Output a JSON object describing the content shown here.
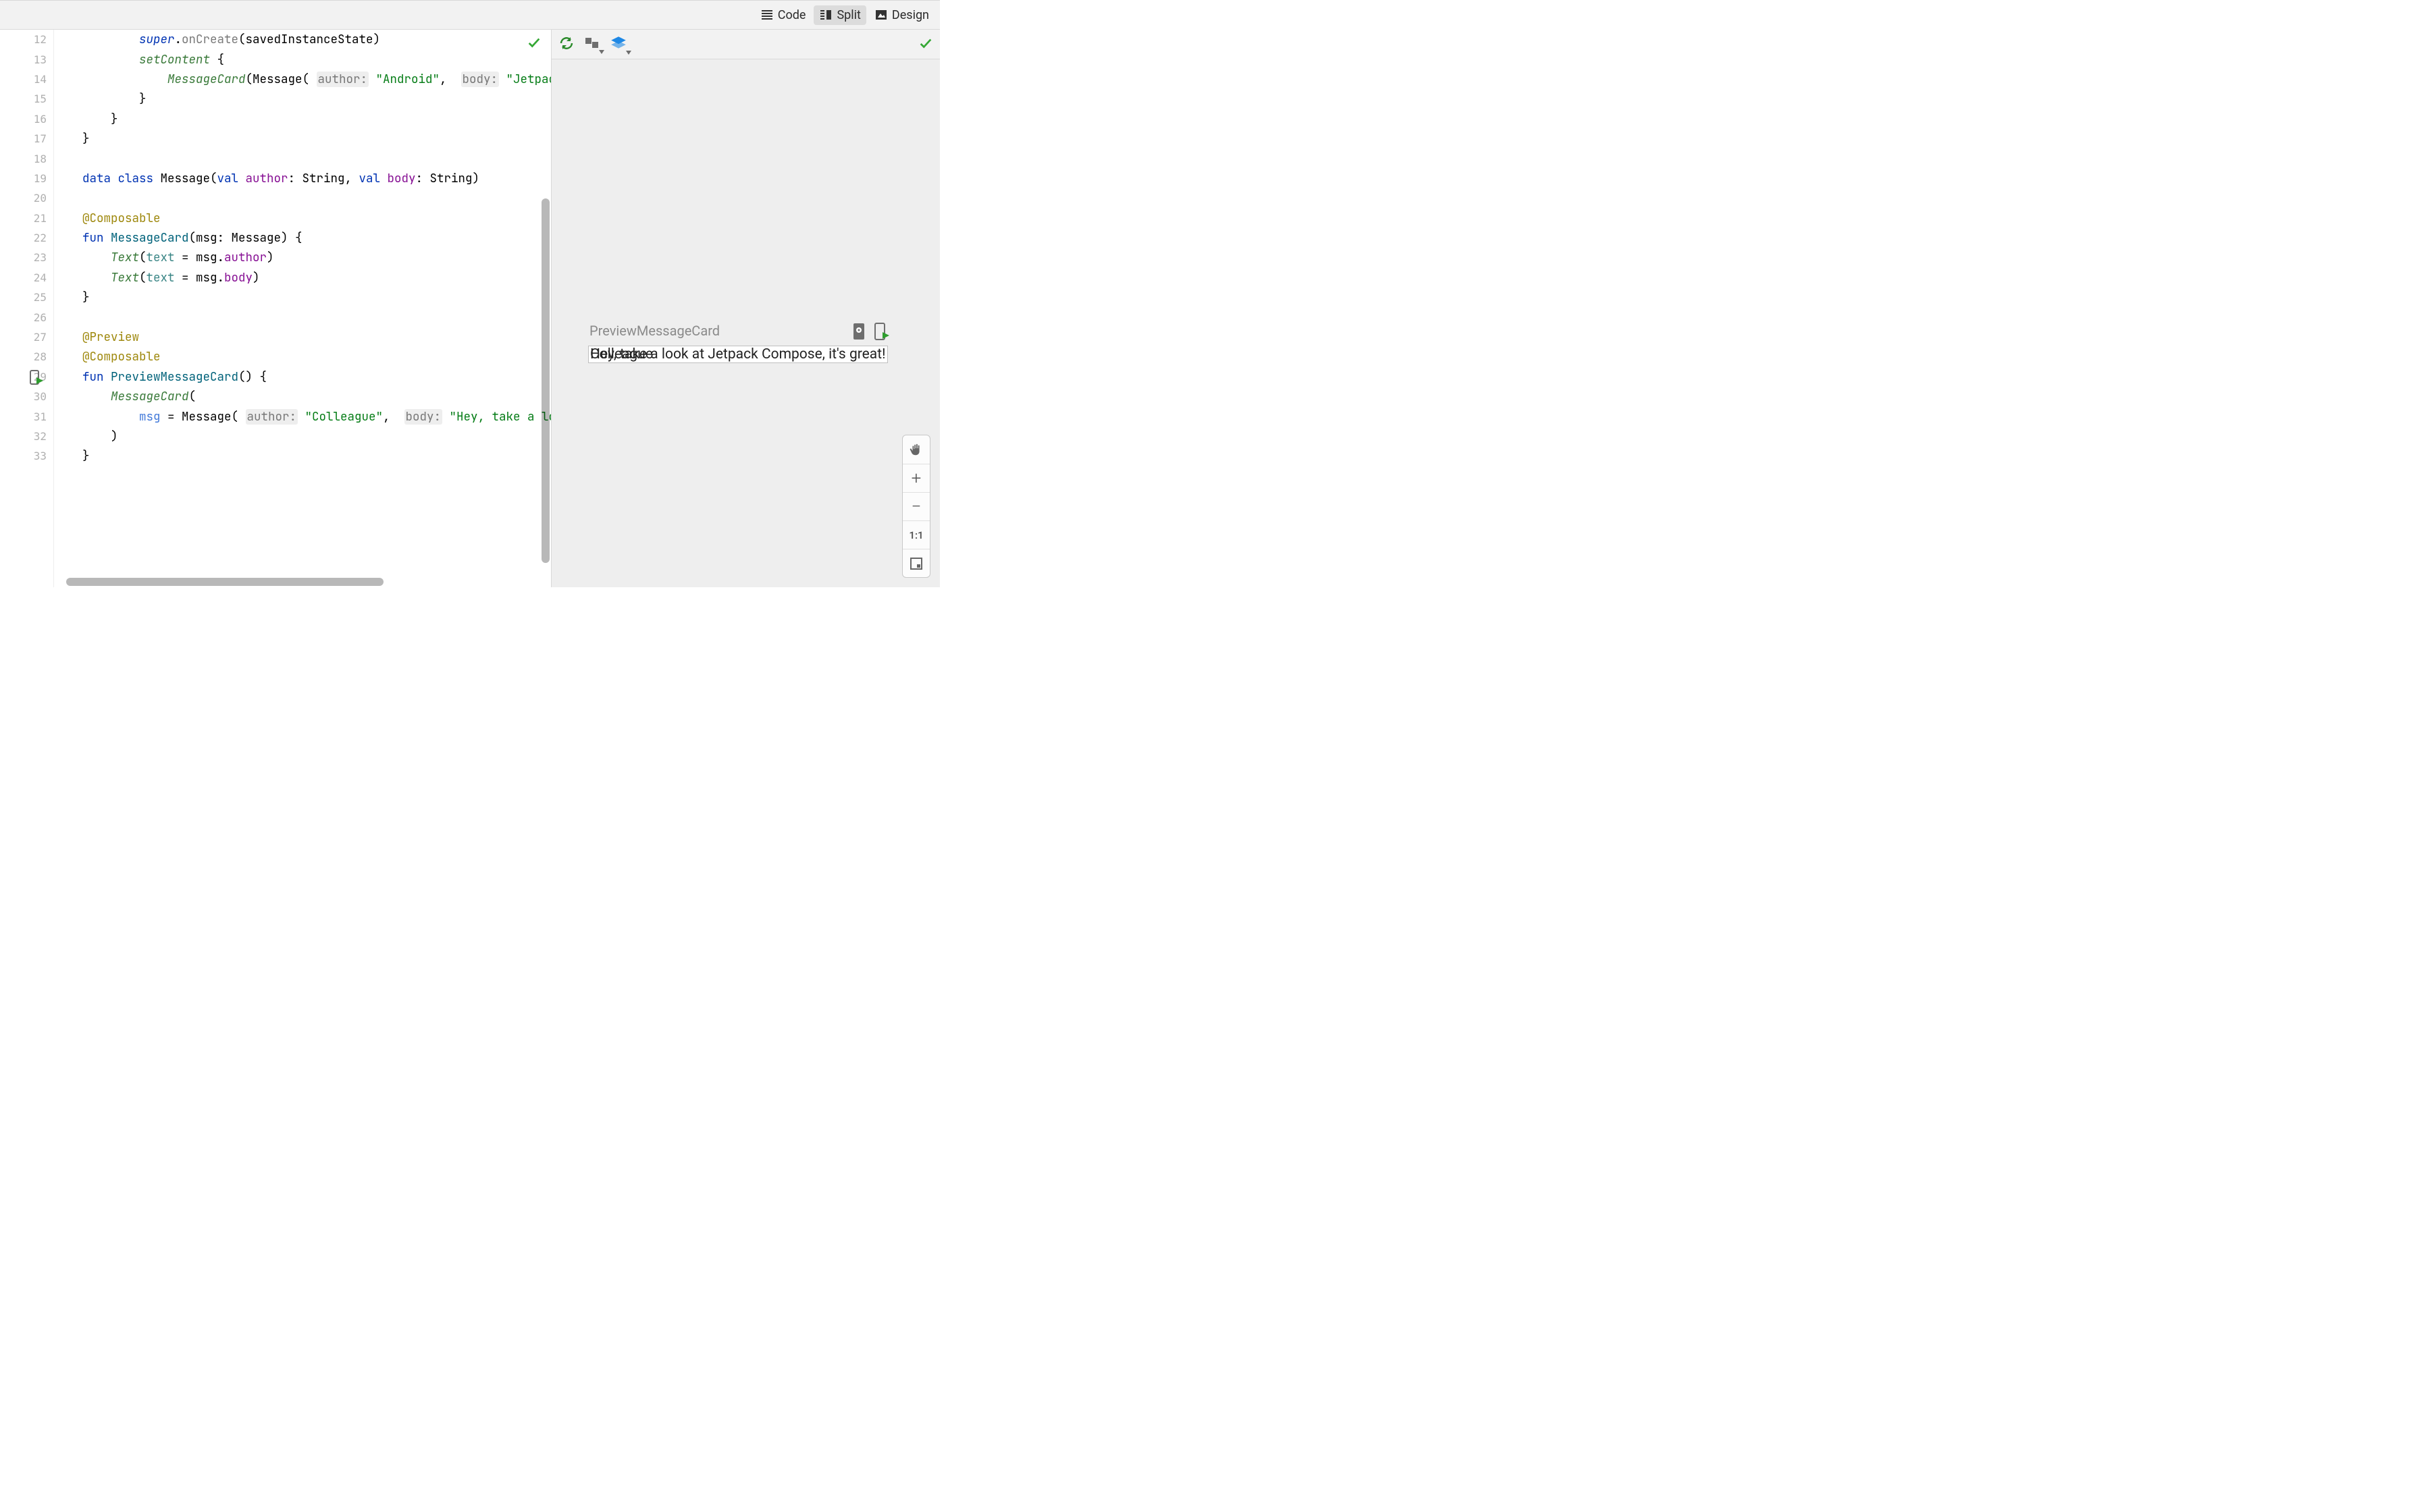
{
  "toolbar": {
    "code": "Code",
    "split": "Split",
    "design": "Design",
    "active": "split"
  },
  "editor": {
    "first_line": 12,
    "lines": [
      {
        "n": 12,
        "segs": [
          [
            "p",
            "            "
          ],
          [
            "supr",
            "super"
          ],
          [
            "p",
            "."
          ],
          [
            "m",
            "onCreate"
          ],
          [
            "p",
            "(savedInstanceState)"
          ]
        ]
      },
      {
        "n": 13,
        "segs": [
          [
            "p",
            "            "
          ],
          [
            "call",
            "setContent"
          ],
          [
            "p",
            " {"
          ]
        ]
      },
      {
        "n": 14,
        "segs": [
          [
            "p",
            "                "
          ],
          [
            "call",
            "MessageCard"
          ],
          [
            "p",
            "(Message( "
          ],
          [
            "hint",
            "author:"
          ],
          [
            "p",
            " "
          ],
          [
            "str",
            "\"Android\""
          ],
          [
            "p",
            ",  "
          ],
          [
            "hint",
            "body:"
          ],
          [
            "p",
            " "
          ],
          [
            "str",
            "\"Jetpack Compose\""
          ],
          [
            "p",
            "))"
          ]
        ]
      },
      {
        "n": 15,
        "segs": [
          [
            "p",
            "            }"
          ]
        ]
      },
      {
        "n": 16,
        "segs": [
          [
            "p",
            "        }"
          ]
        ]
      },
      {
        "n": 17,
        "segs": [
          [
            "p",
            "    }"
          ]
        ]
      },
      {
        "n": 18,
        "segs": []
      },
      {
        "n": 19,
        "segs": [
          [
            "p",
            "    "
          ],
          [
            "kw",
            "data class"
          ],
          [
            "p",
            " Message("
          ],
          [
            "kw",
            "val"
          ],
          [
            "p",
            " "
          ],
          [
            "prop",
            "author"
          ],
          [
            "p",
            ": String, "
          ],
          [
            "kw",
            "val"
          ],
          [
            "p",
            " "
          ],
          [
            "prop",
            "body"
          ],
          [
            "p",
            ": String)"
          ]
        ]
      },
      {
        "n": 20,
        "segs": []
      },
      {
        "n": 21,
        "segs": [
          [
            "p",
            "    "
          ],
          [
            "ann",
            "@Composable"
          ]
        ]
      },
      {
        "n": 22,
        "segs": [
          [
            "p",
            "    "
          ],
          [
            "kw",
            "fun"
          ],
          [
            "p",
            " "
          ],
          [
            "fn",
            "MessageCard"
          ],
          [
            "p",
            "(msg: Message) {"
          ]
        ]
      },
      {
        "n": 23,
        "segs": [
          [
            "p",
            "        "
          ],
          [
            "call",
            "Text"
          ],
          [
            "p",
            "("
          ],
          [
            "par",
            "text"
          ],
          [
            "p",
            " = msg."
          ],
          [
            "prop",
            "author"
          ],
          [
            "p",
            ")"
          ]
        ]
      },
      {
        "n": 24,
        "segs": [
          [
            "p",
            "        "
          ],
          [
            "call",
            "Text"
          ],
          [
            "p",
            "("
          ],
          [
            "par",
            "text"
          ],
          [
            "p",
            " = msg."
          ],
          [
            "prop",
            "body"
          ],
          [
            "p",
            ")"
          ]
        ]
      },
      {
        "n": 25,
        "segs": [
          [
            "p",
            "    }"
          ]
        ]
      },
      {
        "n": 26,
        "segs": []
      },
      {
        "n": 27,
        "segs": [
          [
            "p",
            "    "
          ],
          [
            "ann",
            "@Preview"
          ]
        ]
      },
      {
        "n": 28,
        "segs": [
          [
            "p",
            "    "
          ],
          [
            "ann",
            "@Composable"
          ]
        ]
      },
      {
        "n": 29,
        "segs": [
          [
            "p",
            "    "
          ],
          [
            "kw",
            "fun"
          ],
          [
            "p",
            " "
          ],
          [
            "fn",
            "PreviewMessageCard"
          ],
          [
            "p",
            "() {"
          ]
        ],
        "run_icon": true
      },
      {
        "n": 30,
        "segs": [
          [
            "p",
            "        "
          ],
          [
            "call",
            "MessageCard"
          ],
          [
            "p",
            "("
          ]
        ]
      },
      {
        "n": 31,
        "segs": [
          [
            "p",
            "            "
          ],
          [
            "parname",
            "msg"
          ],
          [
            "p",
            " = Message( "
          ],
          [
            "hint",
            "author:"
          ],
          [
            "p",
            " "
          ],
          [
            "str",
            "\"Colleague\""
          ],
          [
            "p",
            ",  "
          ],
          [
            "hint",
            "body:"
          ],
          [
            "p",
            " "
          ],
          [
            "str",
            "\"Hey, take a look at Jetpack Compose, it's great!\""
          ],
          [
            "p",
            ")"
          ]
        ]
      },
      {
        "n": 32,
        "segs": [
          [
            "p",
            "        )"
          ]
        ]
      },
      {
        "n": 33,
        "segs": [
          [
            "p",
            "    }"
          ]
        ]
      }
    ]
  },
  "preview": {
    "label": "PreviewMessageCard",
    "body_text": "Hey, take a look at Jetpack Compose, it's great!",
    "author_text": "Colleague"
  },
  "zoom": {
    "one_to_one": "1:1"
  }
}
